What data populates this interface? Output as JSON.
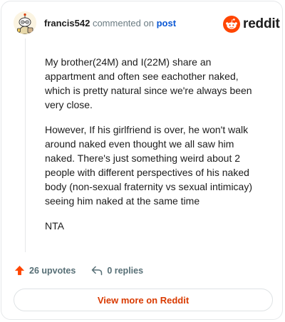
{
  "header": {
    "username": "francis542",
    "verb": "commented on",
    "post_link": "post"
  },
  "logo": {
    "wordmark": "reddit",
    "icon": "reddit-snoo-icon",
    "brand_color": "#ff4500"
  },
  "comment": {
    "paragraphs": [
      "My brother(24M) and I(22M) share an appartment and often see eachother naked, which is pretty natural since we're always been very close.",
      "However, If his girlfriend is over, he won't walk around naked even thought we all saw him naked. There's just something weird about 2 people with different perspectives of his naked body (non-sexual fraternity vs sexual intimicay) seeing him naked at the same time",
      "NTA"
    ]
  },
  "actions": {
    "upvotes": "26 upvotes",
    "replies": "0 replies",
    "upvote_icon": "upvote-arrow-icon",
    "reply_icon": "reply-arrow-icon",
    "upvote_color": "#ff4500"
  },
  "footer": {
    "view_more": "View more on Reddit",
    "accent": "#d93a00"
  }
}
